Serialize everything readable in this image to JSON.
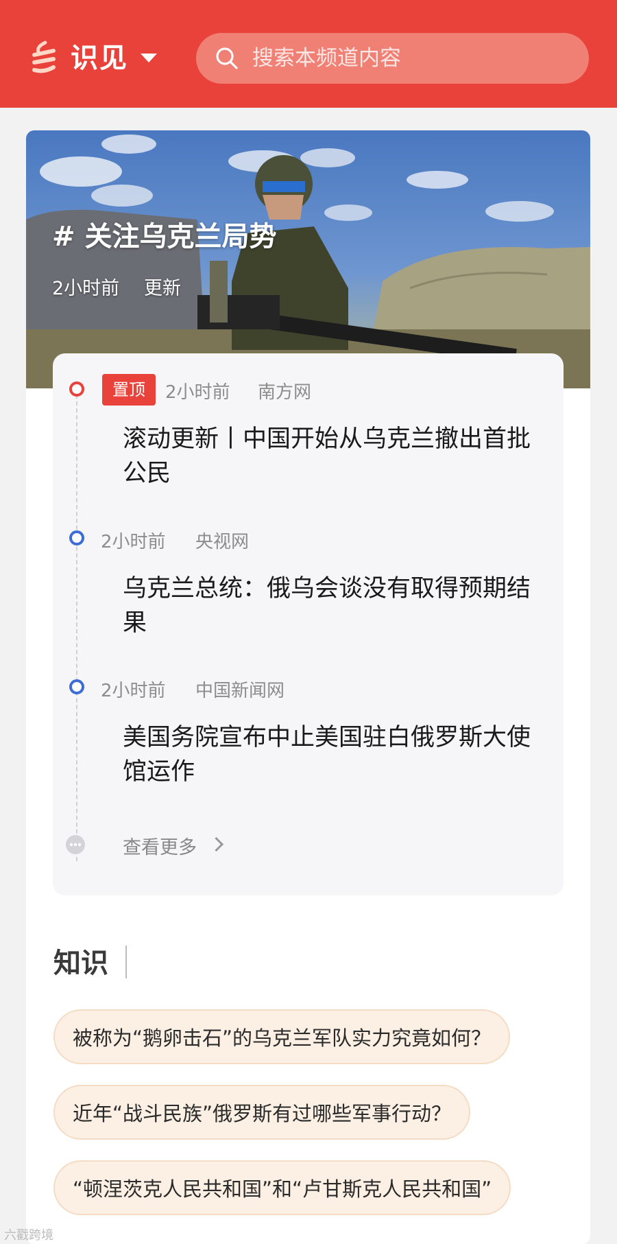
{
  "header": {
    "brand": "识见",
    "search_placeholder": "搜索本频道内容",
    "logo_icon": "channel-logo-icon",
    "search_icon": "search-icon"
  },
  "hero": {
    "title": "# 关注乌克兰局势",
    "time": "2小时前",
    "update": "更新"
  },
  "timeline": {
    "items": [
      {
        "badge": "置顶",
        "time": "2小时前",
        "source": "南方网",
        "headline": "滚动更新丨中国开始从乌克兰撤出首批公民"
      },
      {
        "time": "2小时前",
        "source": "央视网",
        "headline": "乌克兰总统：俄乌会谈没有取得预期结果"
      },
      {
        "time": "2小时前",
        "source": "中国新闻网",
        "headline": "美国务院宣布中止美国驻白俄罗斯大使馆运作"
      }
    ],
    "more": "查看更多"
  },
  "knowledge": {
    "title": "知识",
    "questions": [
      "被称为“鹅卵击石”的乌克兰军队实力究竟如何？",
      "近年“战斗民族”俄罗斯有过哪些军事行动？",
      "“顿涅茨克人民共和国”和“卢甘斯克人民共和国”"
    ]
  },
  "watermark": "六戳跨境",
  "colors": {
    "brand_red": "#e8423a",
    "timeline_blue": "#3d6cd6",
    "chip_bg": "#fcefe3"
  }
}
